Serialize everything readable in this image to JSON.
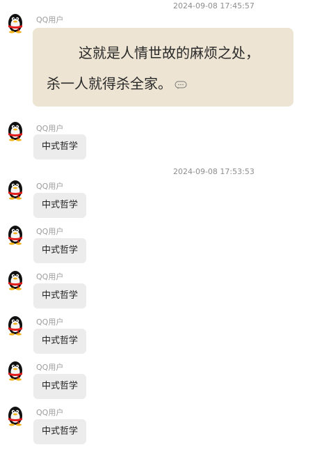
{
  "chat": {
    "timestamps": [
      "2024-09-08 17:45:57",
      "2024-09-08 17:53:53"
    ],
    "sender_name": "QQ用户",
    "first_message": {
      "line1": "这就是人情世故的麻烦之处，",
      "line2": "杀一人就得杀全家。"
    },
    "reply_text": "中式哲学"
  },
  "icons": {
    "avatar": "qq-penguin-icon",
    "emoji": "emoji-bubble-icon"
  }
}
